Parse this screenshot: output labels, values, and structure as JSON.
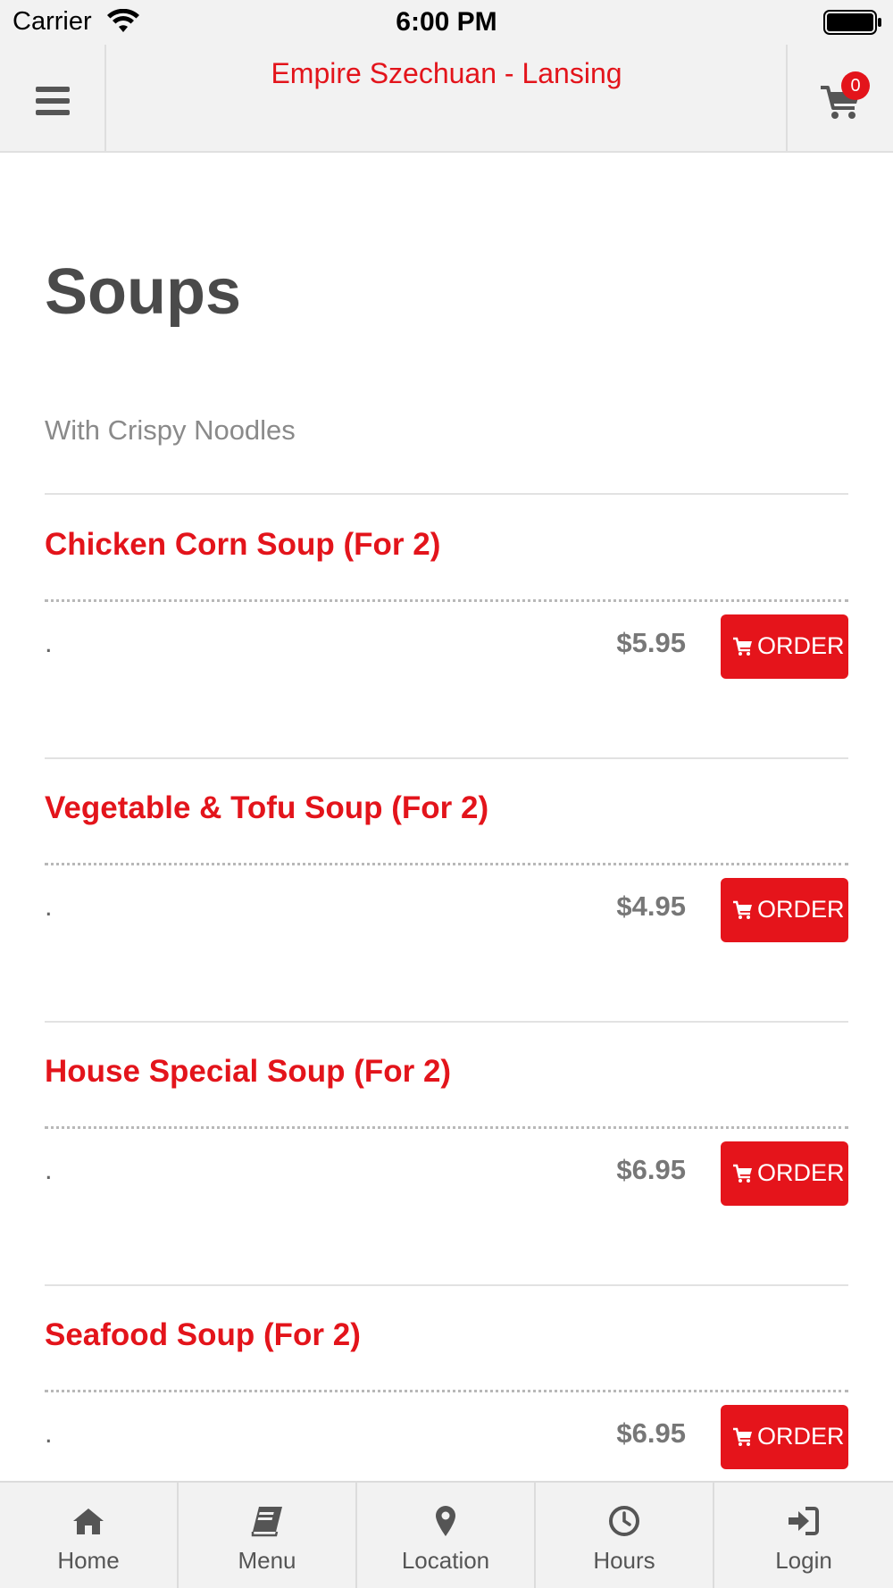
{
  "status_bar": {
    "carrier": "Carrier",
    "time": "6:00 PM"
  },
  "header": {
    "title": "Empire Szechuan - Lansing",
    "cart_count": "0"
  },
  "page": {
    "title": "Soups",
    "description": "With Crispy Noodles"
  },
  "items": [
    {
      "name": "Chicken Corn Soup (For 2)",
      "description": ".",
      "price": "$5.95",
      "order_label": "ORDER"
    },
    {
      "name": "Vegetable & Tofu Soup (For 2)",
      "description": ".",
      "price": "$4.95",
      "order_label": "ORDER"
    },
    {
      "name": "House Special Soup (For 2)",
      "description": ".",
      "price": "$6.95",
      "order_label": "ORDER"
    },
    {
      "name": "Seafood Soup (For 2)",
      "description": ".",
      "price": "$6.95",
      "order_label": "ORDER"
    }
  ],
  "tabs": [
    {
      "label": "Home",
      "icon": "home-icon"
    },
    {
      "label": "Menu",
      "icon": "book-icon"
    },
    {
      "label": "Location",
      "icon": "map-pin-icon"
    },
    {
      "label": "Hours",
      "icon": "clock-icon"
    },
    {
      "label": "Login",
      "icon": "sign-in-icon"
    }
  ],
  "colors": {
    "accent": "#e3141b",
    "title_gray": "#4a4a4a",
    "bar_background": "#f2f2f2"
  }
}
